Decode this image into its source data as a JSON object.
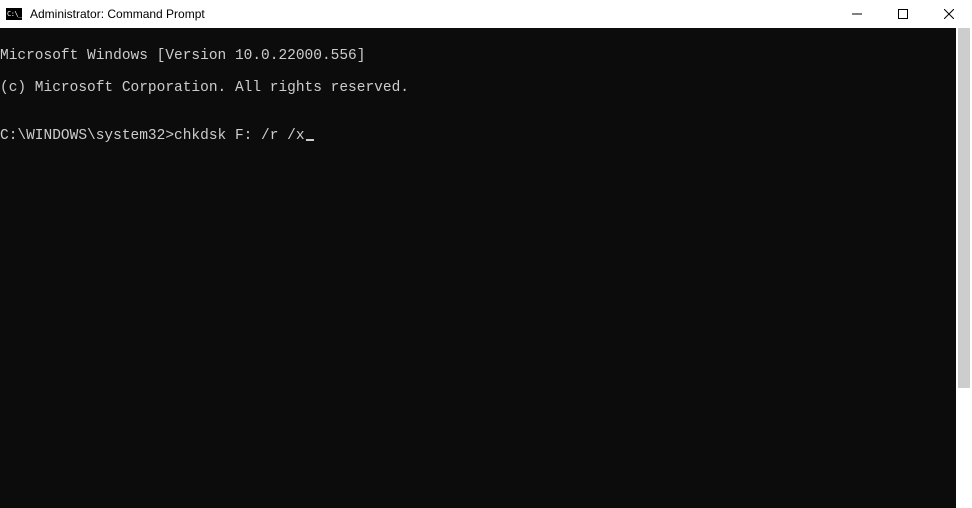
{
  "window": {
    "title": "Administrator: Command Prompt"
  },
  "terminal": {
    "line1": "Microsoft Windows [Version 10.0.22000.556]",
    "line2": "(c) Microsoft Corporation. All rights reserved.",
    "blank": "",
    "prompt": "C:\\WINDOWS\\system32>",
    "command": "chkdsk F: /r /x"
  },
  "scrollbar": {
    "thumb_top_pct": 0,
    "thumb_height_pct": 75
  }
}
